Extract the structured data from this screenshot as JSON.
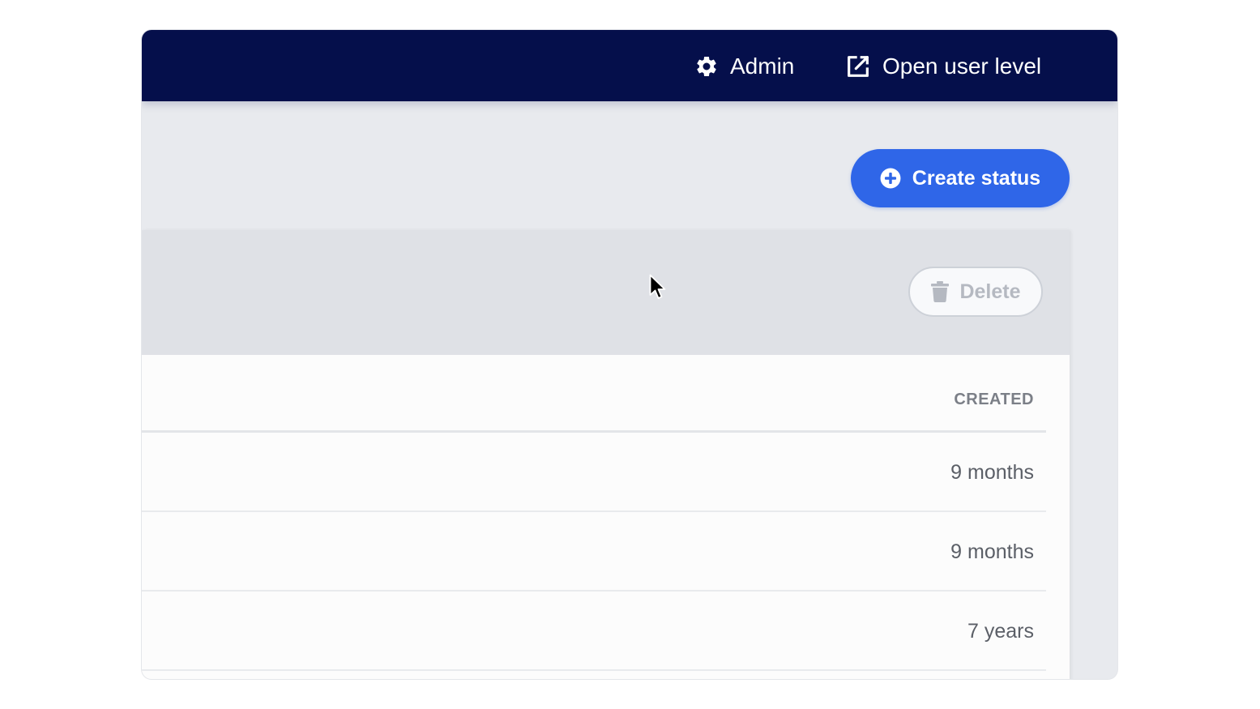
{
  "topbar": {
    "admin_label": "Admin",
    "admin_icon": "gear-icon",
    "open_user_level_label": "Open user level",
    "open_user_level_icon": "external-link-icon",
    "background_color": "#050f4b"
  },
  "actions": {
    "create_label": "Create status",
    "create_icon": "plus-circle-icon",
    "create_color": "#2f66e8"
  },
  "toolbar": {
    "delete_label": "Delete",
    "delete_icon": "trash-icon",
    "delete_disabled": true
  },
  "table": {
    "columns": [
      "CREATED"
    ],
    "rows": [
      {
        "created": "9 months"
      },
      {
        "created": "9 months"
      },
      {
        "created": "7 years"
      }
    ]
  }
}
